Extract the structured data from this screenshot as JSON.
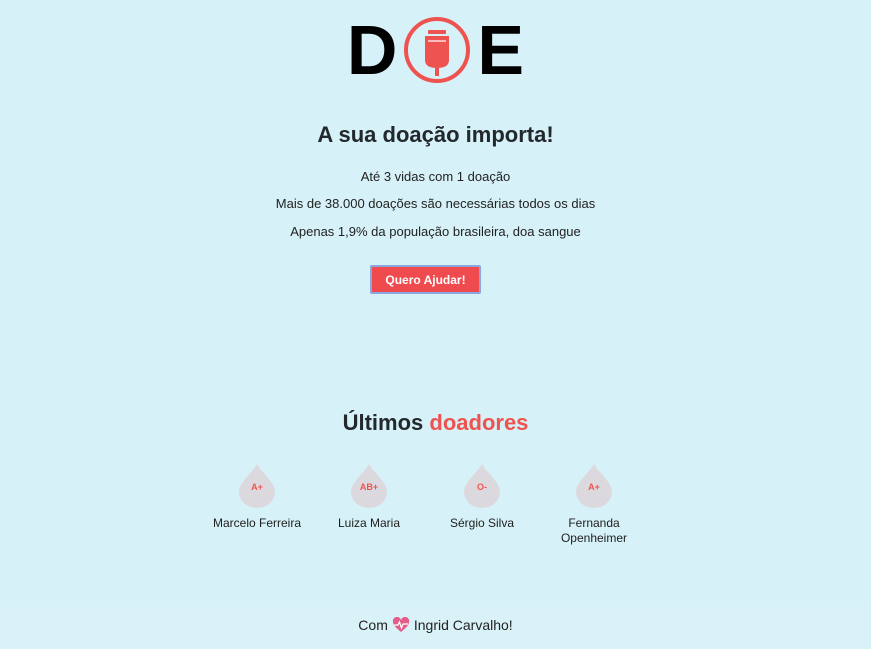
{
  "logo": {
    "letter_left": "D",
    "letter_right": "E",
    "icon": "blood-bag-icon",
    "accent_color": "#ef5350"
  },
  "hero": {
    "title": "A sua doação importa!",
    "facts": [
      "Até 3 vidas com 1 doação",
      "Mais de 38.000 doações são necessárias todos os dias",
      "Apenas 1,9% da população brasileira, doa sangue"
    ],
    "cta_label": "Quero Ajudar!"
  },
  "donors": {
    "title_prefix": "Últimos",
    "title_accent": "doadores",
    "items": [
      {
        "blood_type": "A+",
        "name": "Marcelo Ferreira"
      },
      {
        "blood_type": "AB+",
        "name": "Luiza Maria"
      },
      {
        "blood_type": "O-",
        "name": "Sérgio Silva"
      },
      {
        "blood_type": "A+",
        "name": "Fernanda Openheimer"
      }
    ]
  },
  "footer": {
    "prefix": "Com",
    "icon": "heart-pulse-icon",
    "author": "Ingrid Carvalho!"
  },
  "colors": {
    "background": "#d6f1f7",
    "accent": "#ef5350",
    "button": "#ef4b4f",
    "drop": "#dcd9de"
  }
}
